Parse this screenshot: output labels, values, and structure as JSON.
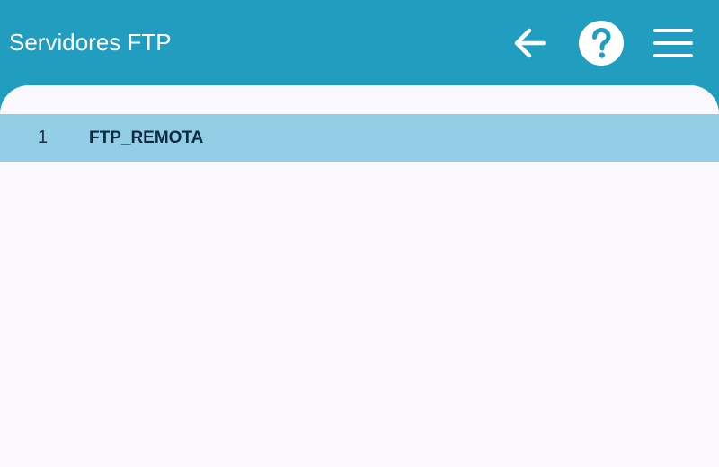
{
  "app_bar": {
    "title": "Servidores FTP",
    "actions": [
      {
        "name": "back",
        "icon": "arrow-left-icon"
      },
      {
        "name": "help",
        "icon": "help-circle-icon"
      },
      {
        "name": "menu",
        "icon": "hamburger-menu-icon"
      }
    ]
  },
  "servers": [
    {
      "index": "1",
      "name": "FTP_REMOTA"
    }
  ],
  "colors": {
    "app_bar": "#219dbf",
    "content_background": "#faf8fd",
    "selected_row": "#92cee6",
    "text_dark": "#0d2a40"
  }
}
